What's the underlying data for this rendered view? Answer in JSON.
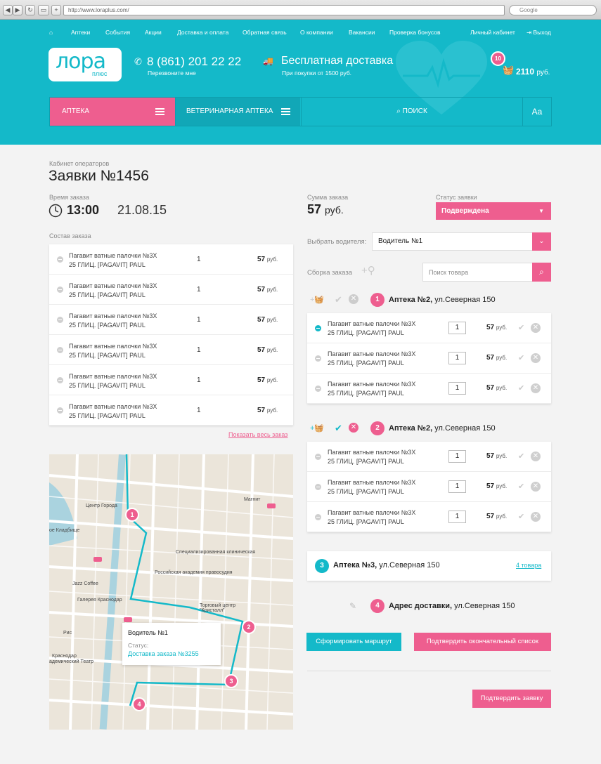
{
  "browser": {
    "url": "http://www.loraplus.com/",
    "search_placeholder": "Google"
  },
  "nav": {
    "home_icon": "home-icon",
    "items": [
      "Аптеки",
      "События",
      "Акции",
      "Доставка и оплата",
      "Обратная связь",
      "О компании",
      "Вакансии",
      "Проверка бонусов"
    ],
    "cabinet": "Личный кабинет",
    "logout": "Выход"
  },
  "logo": {
    "main": "лора",
    "sub": "плюс"
  },
  "phone": {
    "number": "8 (861) 201 22 22",
    "callback": "Перезвоните мне"
  },
  "delivery": {
    "title": "Бесплатная доставка",
    "note": "При покупки от 1500 руб."
  },
  "cart": {
    "count": "10",
    "sum": "2110",
    "currency": "руб."
  },
  "menu": {
    "pharmacy": "Аптека",
    "vet": "Ветеринарная аптека",
    "search": "Поиск",
    "font": "Aa"
  },
  "page": {
    "breadcrumb": "Кабинет операторов",
    "title": "Заявки №1456"
  },
  "order": {
    "time_label": "Время заказа",
    "time": "13:00",
    "date": "21.08.15",
    "sum_label": "Сумма заказа",
    "sum": "57",
    "sum_currency": "руб.",
    "status_label": "Статус заявки",
    "status": "Подверждена",
    "composition_label": "Состав заказа",
    "items": [
      {
        "name1": "Пагавит  ватные палочки №3Х",
        "name2": "25 ГЛИЦ. [PAGAVIT] PAUL",
        "qty": "1",
        "price": "57",
        "cur": "руб."
      },
      {
        "name1": "Пагавит  ватные палочки №3Х",
        "name2": "25 ГЛИЦ. [PAGAVIT] PAUL",
        "qty": "1",
        "price": "57",
        "cur": "руб."
      },
      {
        "name1": "Пагавит  ватные палочки №3Х",
        "name2": "25 ГЛИЦ. [PAGAVIT] PAUL",
        "qty": "1",
        "price": "57",
        "cur": "руб."
      },
      {
        "name1": "Пагавит  ватные палочки №3Х",
        "name2": "25 ГЛИЦ. [PAGAVIT] PAUL",
        "qty": "1",
        "price": "57",
        "cur": "руб."
      },
      {
        "name1": "Пагавит  ватные палочки №3Х",
        "name2": "25 ГЛИЦ. [PAGAVIT] PAUL",
        "qty": "1",
        "price": "57",
        "cur": "руб."
      },
      {
        "name1": "Пагавит  ватные палочки №3Х",
        "name2": "25 ГЛИЦ. [PAGAVIT] PAUL",
        "qty": "1",
        "price": "57",
        "cur": "руб."
      }
    ],
    "show_all": "Показать весь заказ"
  },
  "driver": {
    "label": "Выбрать водителя:",
    "value": "Водитель №1"
  },
  "assembly": {
    "label": "Сборка заказа",
    "search_placeholder": "Поиск товара"
  },
  "groups": [
    {
      "num": "1",
      "name": "Аптека №2,",
      "addr": "ул.Северная 150",
      "items": [
        {
          "name1": "Пагавит  ватные палочки №3Х",
          "name2": "25 ГЛИЦ. [PAGAVIT] PAUL",
          "qty": "1",
          "price": "57",
          "cur": "руб."
        },
        {
          "name1": "Пагавит  ватные палочки №3Х",
          "name2": "25 ГЛИЦ. [PAGAVIT] PAUL",
          "qty": "1",
          "price": "57",
          "cur": "руб."
        },
        {
          "name1": "Пагавит  ватные палочки №3Х",
          "name2": "25 ГЛИЦ. [PAGAVIT] PAUL",
          "qty": "1",
          "price": "57",
          "cur": "руб."
        }
      ]
    },
    {
      "num": "2",
      "name": "Аптека №2,",
      "addr": "ул.Северная 150",
      "items": [
        {
          "name1": "Пагавит  ватные палочки №3Х",
          "name2": "25 ГЛИЦ. [PAGAVIT] PAUL",
          "qty": "1",
          "price": "57",
          "cur": "руб."
        },
        {
          "name1": "Пагавит  ватные палочки №3Х",
          "name2": "25 ГЛИЦ. [PAGAVIT] PAUL",
          "qty": "1",
          "price": "57",
          "cur": "руб."
        },
        {
          "name1": "Пагавит  ватные палочки №3Х",
          "name2": "25 ГЛИЦ. [PAGAVIT] PAUL",
          "qty": "1",
          "price": "57",
          "cur": "руб."
        }
      ]
    }
  ],
  "group3": {
    "num": "3",
    "name": "Аптека №3,",
    "addr": "ул.Северная 150",
    "link": "4 товара"
  },
  "delivery_addr": {
    "num": "4",
    "name": "Адрес доставки,",
    "addr": "ул.Северная 150"
  },
  "buttons": {
    "route": "Сформировать маршрут",
    "confirm_list": "Подтвердить окончательный список",
    "confirm_order": "Подтвердить заявку"
  },
  "map": {
    "popup_title": "Водитель №1",
    "popup_status_label": "Статус:",
    "popup_status": "Доставка заказа №3255",
    "labels": [
      "Центр Города",
      "Магнит",
      "ое Кладбище",
      "Специализированная клиническая",
      "Российская академия правосудия",
      "Jazz Coffee",
      "Галерея Краснодар",
      "Торговый центр \"Кристалл\"",
      "Рис",
      "Краснодар",
      "адемический Театр"
    ],
    "pins": [
      "1",
      "2",
      "3",
      "4"
    ]
  },
  "colors": {
    "teal": "#14b9c9",
    "pink": "#ee5e8f"
  }
}
